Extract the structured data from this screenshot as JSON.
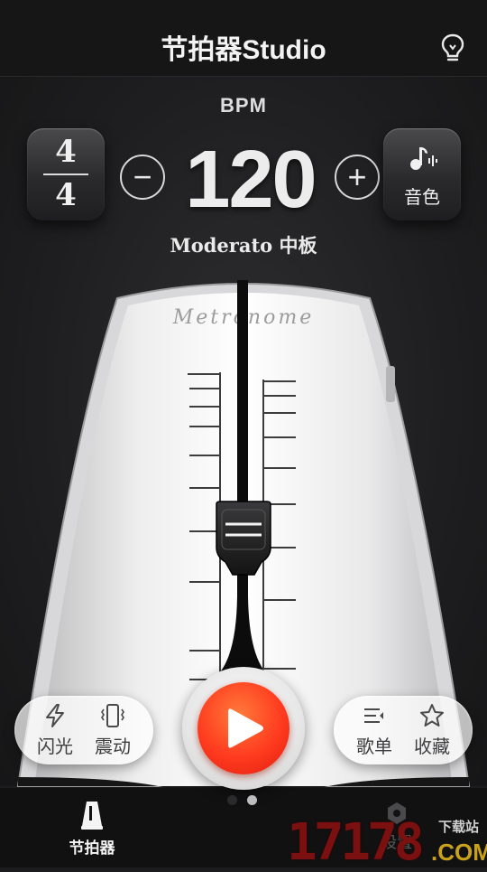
{
  "header": {
    "title": "节拍器Studio",
    "bulb_icon": "lightbulb-icon"
  },
  "bpm_panel": {
    "label": "BPM",
    "value": "120",
    "tempo_name": "Moderato 中板",
    "time_signature": {
      "top": "4",
      "bottom": "4"
    },
    "decrease_symbol": "−",
    "increase_symbol": "+",
    "sound_label": "音色",
    "sound_icon": "music-note-icon"
  },
  "metronome": {
    "brand_text": "Metronome"
  },
  "left_pill": {
    "flash_label": "闪光",
    "vibrate_label": "震动"
  },
  "right_pill": {
    "playlist_label": "歌单",
    "favorite_label": "收藏"
  },
  "page_indicator": {
    "count": 2,
    "active_index": 0
  },
  "bottom_nav": {
    "metronome_tab": "节拍器",
    "settings_tab": "设置"
  },
  "watermark": {
    "number": "17178",
    "site": "下载站",
    "domain": ".COM"
  },
  "colors": {
    "accent": "#ff3b1f",
    "background": "#1c1c1e",
    "pill_text": "#3e3e40"
  }
}
